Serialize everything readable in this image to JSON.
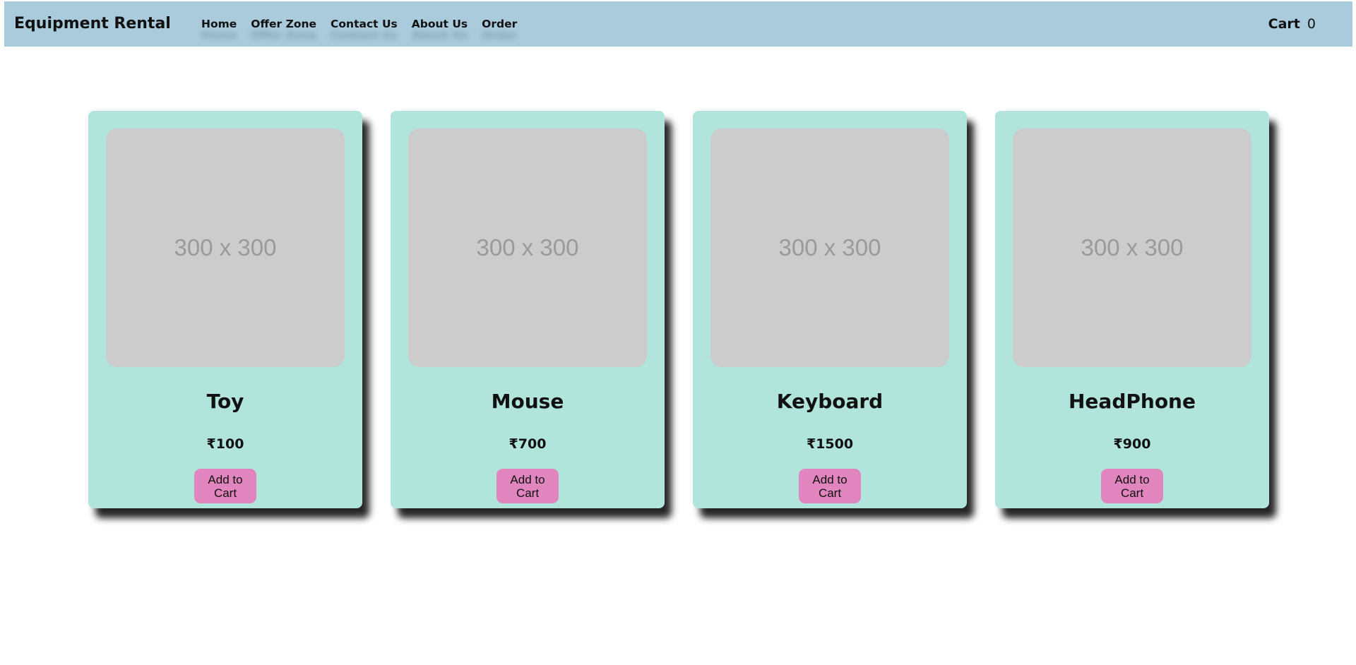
{
  "header": {
    "brand": "Equipment Rental",
    "nav": [
      "Home",
      "Offer Zone",
      "Contact Us",
      "About Us",
      "Order"
    ],
    "cart_label": "Cart",
    "cart_count": "0",
    "background": "#a9cbdc"
  },
  "products": [
    {
      "image_text": "300 x 300",
      "name": "Toy",
      "price": "₹100",
      "button": "Add to Cart"
    },
    {
      "image_text": "300 x 300",
      "name": "Mouse",
      "price": "₹700",
      "button": "Add to Cart"
    },
    {
      "image_text": "300 x 300",
      "name": "Keyboard",
      "price": "₹1500",
      "button": "Add to Cart"
    },
    {
      "image_text": "300 x 300",
      "name": "HeadPhone",
      "price": "₹900",
      "button": "Add to Cart"
    }
  ],
  "colors": {
    "card_background": "#b1e5db",
    "image_placeholder": "#cccccc",
    "button": "#e085bd"
  }
}
